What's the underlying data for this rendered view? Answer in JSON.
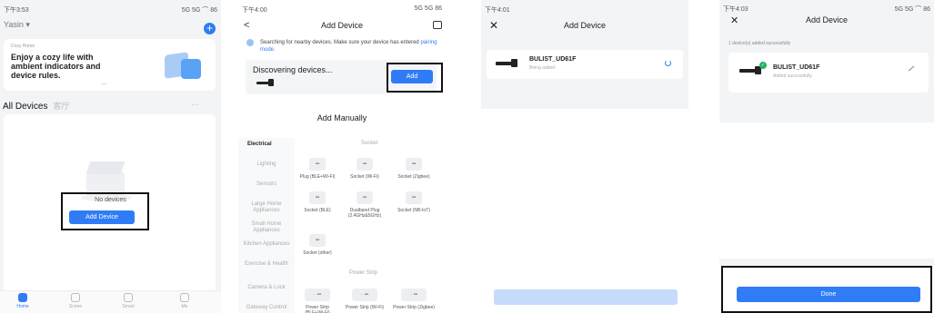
{
  "panel1": {
    "status_time": "下午3:53",
    "status_right": "5G 5G ⌒ 86",
    "home_name": "Yasin",
    "banner_small": "Cozy Home",
    "banner_text": "Enjoy a cozy life with ambient indicators and device rules.",
    "tab_all": "All Devices",
    "tab_room": "客厅",
    "more": "···",
    "empty_text": "No devices",
    "add_device_label": "Add Device",
    "tabs": [
      {
        "label": "Home",
        "icon": "home-icon"
      },
      {
        "label": "Scene",
        "icon": "scene-icon"
      },
      {
        "label": "Smart",
        "icon": "smart-icon"
      },
      {
        "label": "Me",
        "icon": "me-icon"
      }
    ]
  },
  "panel2": {
    "status_time": "下午4:00",
    "status_right": "5G 5G 86",
    "title": "Add Device",
    "info_text": "Searching for nearby devices. Make sure your device has entered",
    "info_link": "pairing mode.",
    "discovering": "Discovering devices...",
    "add_label": "Add",
    "add_manually": "Add Manually",
    "categories": [
      "Electrical",
      "Lighting",
      "Sensors",
      "Large Home Appliances",
      "Small Home Appliances",
      "Kitchen Appliances",
      "Exercise & Health",
      "Camera & Lock",
      "Gateway Control"
    ],
    "section_socket": "Socket",
    "section_power_strip": "Power Strip",
    "devices": [
      "Plug (BLE+Wi-Fi)",
      "Socket (Wi-Fi)",
      "Socket (Zigbee)",
      "Socket (BLE)",
      "Dualband Plug (2.4GHz&5GHz)",
      "Socket (NB-IoT)",
      "Socket (other)",
      "Power Strip (BLE+Wi-Fi)",
      "Power Strip (Wi-Fi)",
      "Power Strip (Zigbee)"
    ]
  },
  "panel3": {
    "status_time": "下午4:01",
    "title": "Add Device",
    "device_name": "BULIST_UD61F",
    "device_status": "Being added"
  },
  "panel4": {
    "status_time": "下午4:03",
    "status_right": "5G 5G ⌒ 86",
    "title": "Add Device",
    "added_msg": "1 device(s) added successfully",
    "device_name": "BULIST_UD61F",
    "device_status": "Added successfully",
    "done_label": "Done"
  },
  "colors": {
    "accent": "#2f7cf6",
    "success": "#22b35e"
  }
}
